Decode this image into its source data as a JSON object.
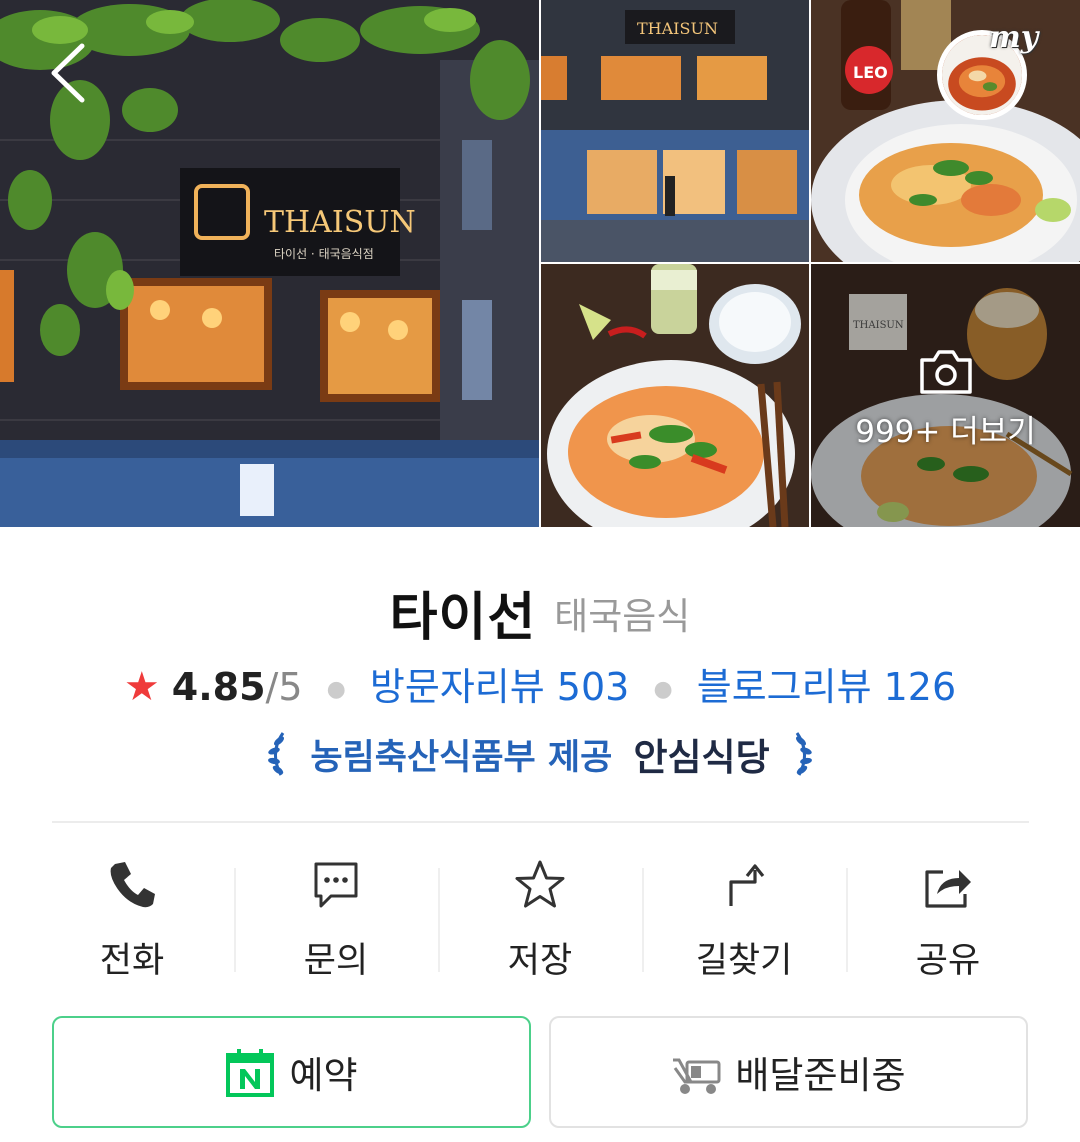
{
  "gallery": {
    "main_sign_text": "THAISUN",
    "main_sign_sub": "타이선 · 태국음식점",
    "bottle_label": "LEO",
    "menu_card_text": "THAISUN",
    "my_badge_text": "my",
    "more_label": "999+ 더보기"
  },
  "place": {
    "name": "타이선",
    "category": "태국음식",
    "rating_star": "★",
    "rating_score": "4.85",
    "rating_max": "/5",
    "visitor_reviews": "방문자리뷰 503",
    "blog_reviews": "블로그리뷰 126",
    "cert_provider": "농림축산식품부 제공",
    "cert_badge": "안심식당"
  },
  "actions": [
    {
      "label": "전화",
      "icon": "phone-icon"
    },
    {
      "label": "문의",
      "icon": "chat-icon"
    },
    {
      "label": "저장",
      "icon": "star-icon"
    },
    {
      "label": "길찾기",
      "icon": "directions-icon"
    },
    {
      "label": "공유",
      "icon": "share-icon"
    }
  ],
  "buttons": {
    "reserve": "예약",
    "delivery": "배달준비중"
  },
  "colors": {
    "link": "#1c6bd4",
    "rating_star": "#ef3b3b",
    "naver_green": "#03c75a",
    "reserve_border": "#4cd08a"
  }
}
